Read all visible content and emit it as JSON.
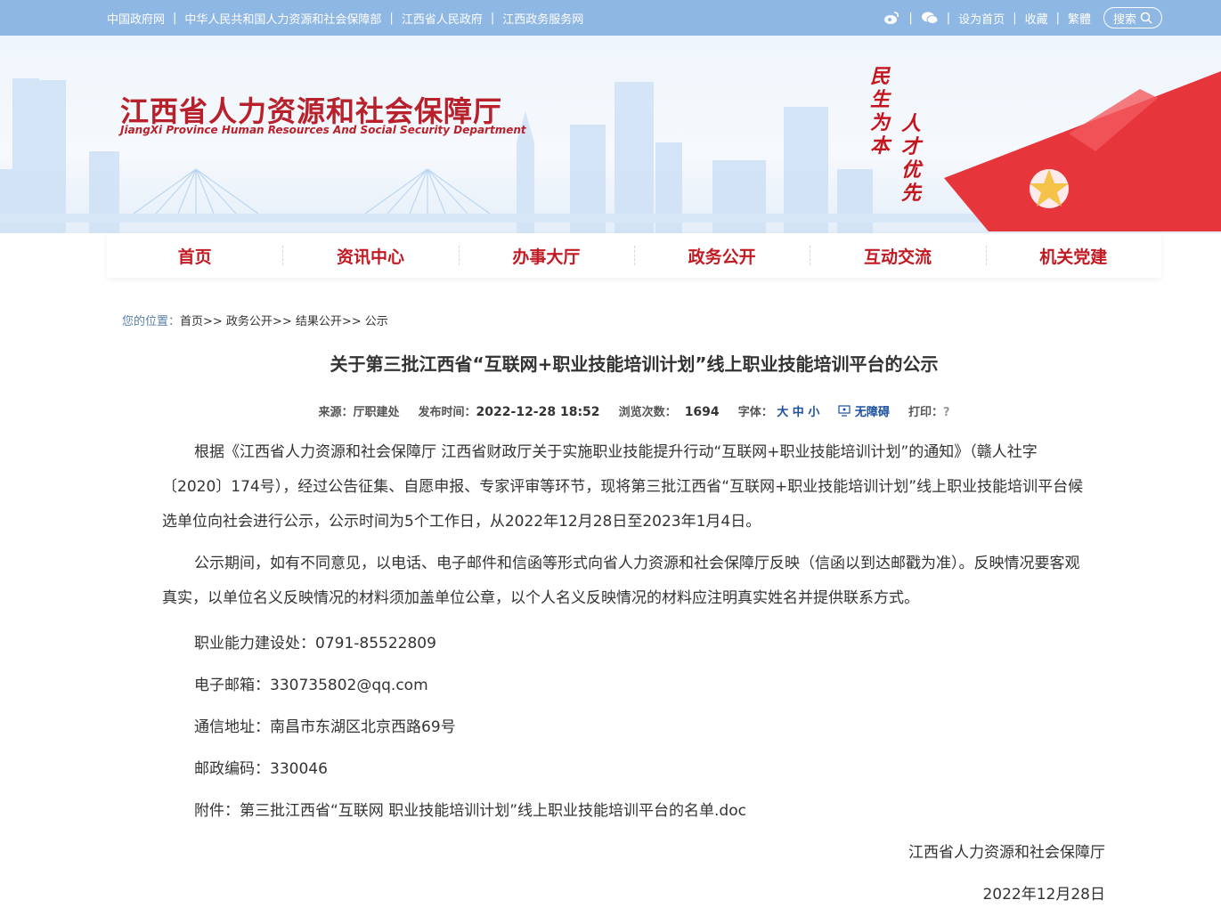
{
  "topbar": {
    "links": [
      "中国政府网",
      "中华人民共和国人力资源和社会保障部",
      "江西省人民政府",
      "江西政务服务网"
    ],
    "right": [
      "设为首页",
      "收藏",
      "繁體"
    ],
    "search_label": "搜索",
    "icons": [
      "weibo-icon",
      "wechat-icon",
      "search-icon"
    ]
  },
  "banner": {
    "title": "江西省人力资源和社会保障厅",
    "subtitle": "JiangXi Province Human Resources And Social Security Department",
    "slogan_left": "民生为本",
    "slogan_right": "人才优先"
  },
  "nav": {
    "items": [
      "首页",
      "资讯中心",
      "办事大厅",
      "政务公开",
      "互动交流",
      "机关党建"
    ]
  },
  "breadcrumb": {
    "label": "您的位置：",
    "path": "首页>> 政务公开>> 结果公开>> 公示"
  },
  "article": {
    "title": "关于第三批江西省“互联网+职业技能培训计划”线上职业技能培训平台的公示",
    "meta": {
      "source_label": "来源：",
      "source": "厅职建处",
      "time_label": "发布时间：",
      "time": "2022-12-28 18:52",
      "views_label": "浏览次数：",
      "views": "1694",
      "font_label": "字体：",
      "font_sizes": "大 中 小",
      "accessible": "无障碍",
      "print_label": "打印：",
      "print": "?"
    },
    "p1": "根据《江西省人力资源和社会保障厅 江西省财政厅关于实施职业技能提升行动“互联网+职业技能培训计划”的通知》（赣人社字〔2020〕174号），经过公告征集、自愿申报、专家评审等环节，现将第三批江西省“互联网+职业技能培训计划”线上职业技能培训平台候选单位向社会进行公示，公示时间为5个工作日，从2022年12月28日至2023年1月4日。",
    "p2": "公示期间，如有不同意见，以电话、电子邮件和信函等形式向省人力资源和社会保障厅反映（信函以到达邮戳为准）。反映情况要客观真实，以单位名义反映情况的材料须加盖单位公章，以个人名义反映情况的材料应注明真实姓名并提供联系方式。",
    "phone": "职业能力建设处：0791-85522809",
    "email": "电子邮箱：330735802@qq.com",
    "address": "通信地址：南昌市东湖区北京西路69号",
    "postcode": "邮政编码：330046",
    "attachment_label": "附件：",
    "attachment": "第三批江西省“互联网 职业技能培训计划”线上职业技能培训平台的名单.doc",
    "sign_org": "江西省人力资源和社会保障厅",
    "sign_date": "2022年12月28日"
  },
  "colors": {
    "topbar": "#8fb7e3",
    "brand_red": "#b8212b",
    "nav_red": "#c21a22",
    "link_blue": "#1c4fa0"
  }
}
